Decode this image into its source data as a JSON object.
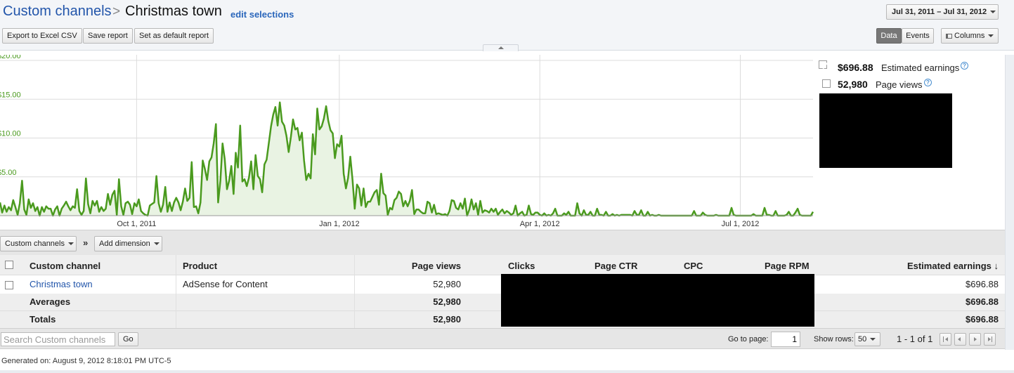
{
  "header": {
    "breadcrumb_root": "Custom channels",
    "breadcrumb_sep": ">",
    "breadcrumb_current": "Christmas town",
    "edit_link": "edit selections",
    "date_range": "Jul 31, 2011 – Jul 31, 2012",
    "export_label": "Export to Excel CSV",
    "save_label": "Save report",
    "default_label": "Set as default report",
    "data_tab": "Data",
    "events_tab": "Events",
    "columns_label": "Columns"
  },
  "legend": {
    "earnings_value": "$696.88",
    "earnings_label": "Estimated earnings",
    "pageviews_value": "52,980",
    "pageviews_label": "Page views",
    "help_glyph": "?"
  },
  "chart_data": {
    "type": "area",
    "series": [
      {
        "color": "#4a9a1e",
        "values": [
          1.7,
          0.4,
          1.3,
          0.5,
          1.1,
          0.7,
          2.0,
          1.1,
          0.1,
          1.6,
          4.5,
          0.8,
          0.1,
          2.1,
          1.0,
          1.6,
          0.6,
          1.1,
          0.0,
          1.1,
          0.5,
          1.2,
          0.9,
          0.9,
          0.0,
          0.8,
          1.2,
          0.0,
          0.9,
          1.3,
          1.8,
          1.2,
          0.7,
          1.2,
          1.0,
          3.4,
          0.6,
          0.1,
          0.6,
          4.8,
          1.5,
          0.3,
          1.9,
          1.3,
          1.9,
          0.5,
          1.1,
          0.6,
          0.9,
          2.8,
          1.4,
          2.7,
          3.2,
          0.1,
          4.7,
          1.2,
          0.1,
          1.6,
          1.8,
          1.4,
          0.2,
          1.6,
          1.2,
          2.1,
          0.6,
          0.3,
          0.1,
          0.0,
          1.3,
          1.5,
          1.7,
          5.1,
          1.6,
          0.5,
          1.4,
          3.7,
          0.5,
          1.7,
          0.6,
          1.7,
          2.3,
          1.7,
          0.7,
          1.8,
          3.5,
          1.9,
          2.3,
          6.9,
          1.1,
          1.2,
          0.3,
          1.7,
          7.1,
          6.0,
          4.6,
          7.0,
          7.5,
          9.3,
          11.8,
          1.7,
          4.5,
          9.3,
          7.3,
          3.4,
          4.5,
          6.4,
          2.8,
          8.1,
          6.2,
          11.6,
          4.4,
          4.7,
          3.8,
          4.9,
          7.0,
          3.4,
          7.8,
          5.1,
          4.7,
          3.0,
          6.6,
          7.2,
          9.3,
          11.5,
          13.0,
          14.0,
          11.6,
          14.6,
          12.1,
          11.6,
          10.3,
          8.2,
          10.1,
          12.4,
          11.1,
          11.3,
          9.7,
          10.7,
          7.1,
          4.6,
          5.4,
          4.8,
          10.5,
          7.9,
          13.8,
          11.1,
          11.5,
          12.5,
          14.1,
          12.2,
          11.0,
          10.6,
          7.4,
          9.2,
          8.9,
          10.3,
          5.4,
          3.5,
          4.9,
          7.6,
          4.6,
          0.9,
          4.0,
          3.5,
          1.3,
          3.5,
          1.1,
          1.8,
          1.8,
          2.4,
          3.0,
          3.3,
          1.4,
          5.4,
          2.9,
          2.6,
          0.1,
          1.0,
          0.8,
          2.0,
          2.3,
          3.1,
          2.8,
          1.2,
          1.9,
          1.2,
          1.9,
          3.3,
          0.2,
          0.8,
          0.8,
          0.5,
          0.3,
          0.3,
          1.8,
          1.6,
          0.4,
          1.4,
          0.2,
          0.3,
          0.2,
          0.1,
          0.2,
          0.0,
          0.6,
          2.0,
          1.9,
          1.0,
          0.8,
          1.6,
          0.9,
          2.2,
          0.0,
          0.8,
          2.1,
          0.8,
          1.6,
          0.1,
          1.9,
          0.4,
          0.7,
          0.6,
          0.4,
          0.9,
          0.5,
          0.9,
          0.1,
          0.5,
          0.8,
          0.3,
          0.6,
          0.4,
          0.1,
          0.3,
          1.3,
          0.0,
          0.3,
          0.5,
          0.0,
          0.1,
          1.3,
          0.2,
          0.1,
          0.4,
          0.4,
          0.1,
          0.0,
          0.3,
          0.0,
          0.1,
          0.0,
          0.3,
          0.9,
          0.0,
          0.0,
          0.0,
          0.3,
          0.1,
          0.5,
          0.0,
          0.0,
          0.0,
          1.6,
          0.3,
          0.0,
          0.7,
          0.1,
          0.1,
          0.5,
          0.0,
          0.0,
          0.9,
          0.1,
          0.1,
          0.0,
          0.5,
          0.0,
          0.0,
          0.2,
          0.0,
          0.1,
          0.0,
          0.1,
          0.1,
          0.1,
          0.1,
          0.1,
          0.0,
          0.6,
          0.1,
          0.1,
          0.7,
          0.0,
          0.0,
          0.5,
          0.0,
          0.1,
          0.0,
          0.0,
          0.1,
          0.0,
          0.0,
          0.0,
          0.0,
          0.0,
          0.0,
          0.0,
          0.0,
          0.0,
          0.0,
          0.0,
          0.0,
          0.0,
          0.0,
          0.0,
          0.6,
          0.0,
          0.0,
          0.0,
          0.4,
          0.1,
          0.0,
          0.0,
          0.0,
          0.0,
          0.1,
          0.0,
          0.0,
          0.0,
          0.0,
          0.0,
          0.0,
          1.0,
          0.1,
          0.0,
          0.0,
          0.0,
          0.0,
          0.0,
          0.0,
          0.0,
          0.0,
          0.2,
          0.0,
          0.0,
          0.0,
          0.0,
          1.0,
          0.1,
          0.1,
          0.0,
          0.0,
          0.6,
          0.0,
          0.0,
          0.0,
          0.0,
          0.1,
          0.5,
          0.0,
          0.0,
          0.4,
          0.9,
          0.1,
          0.0,
          0.0,
          0.0,
          0.0,
          0.0,
          0.5
        ]
      }
    ],
    "x_ticks": [
      "Oct 1, 2011",
      "Jan 1, 2012",
      "Apr 1, 2012",
      "Jul 1, 2012"
    ],
    "x_tick_index": [
      62,
      154,
      245,
      336
    ],
    "y_ticks": [
      "$20.00",
      "$15.00",
      "$10.00",
      "$5.00"
    ],
    "y_tick_values": [
      20,
      15,
      10,
      5
    ],
    "ylim": [
      0,
      20
    ],
    "grid": true
  },
  "dimension_bar": {
    "dimension_label": "Custom channels",
    "separator": "»",
    "add_dimension_label": "Add dimension"
  },
  "table": {
    "headers": {
      "channel": "Custom channel",
      "product": "Product",
      "pageviews": "Page views",
      "clicks": "Clicks",
      "ctr": "Page CTR",
      "cpc": "CPC",
      "rpm": "Page RPM",
      "earnings": "Estimated earnings ↓"
    },
    "row": {
      "channel": "Christmas town",
      "product": "AdSense for Content",
      "pageviews": "52,980",
      "earnings": "$696.88"
    },
    "averages": {
      "label": "Averages",
      "pageviews": "52,980",
      "earnings": "$696.88"
    },
    "totals": {
      "label": "Totals",
      "pageviews": "52,980",
      "earnings": "$696.88"
    }
  },
  "footer": {
    "search_placeholder": "Search Custom channels",
    "go_label": "Go",
    "goto_label": "Go to page:",
    "page_value": "1",
    "rows_label": "Show rows:",
    "rows_value": "50",
    "range_text": "1 - 1 of 1",
    "generated": "Generated on: August 9, 2012 8:18:01 PM UTC-5"
  }
}
